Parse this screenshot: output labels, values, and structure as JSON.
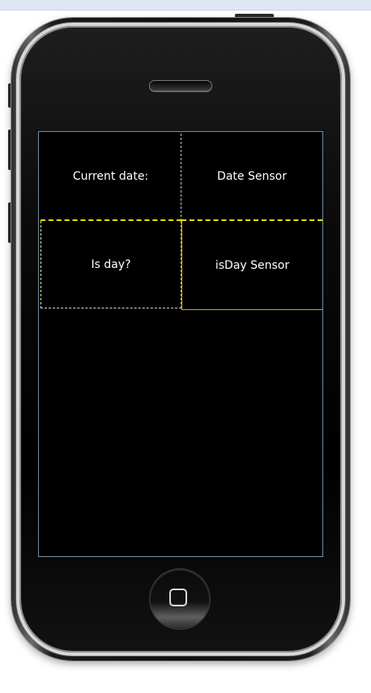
{
  "screen": {
    "rows": [
      {
        "label": "Current date:",
        "sensor": "Date Sensor"
      },
      {
        "label": "Is day?",
        "sensor": "isDay Sensor"
      }
    ]
  },
  "icons": {
    "home": "home-square-icon",
    "speaker": "speaker-slot"
  },
  "colors": {
    "selection_outline": "#ffe000",
    "cell_text": "#ffffff",
    "screen_background": "#000000"
  }
}
